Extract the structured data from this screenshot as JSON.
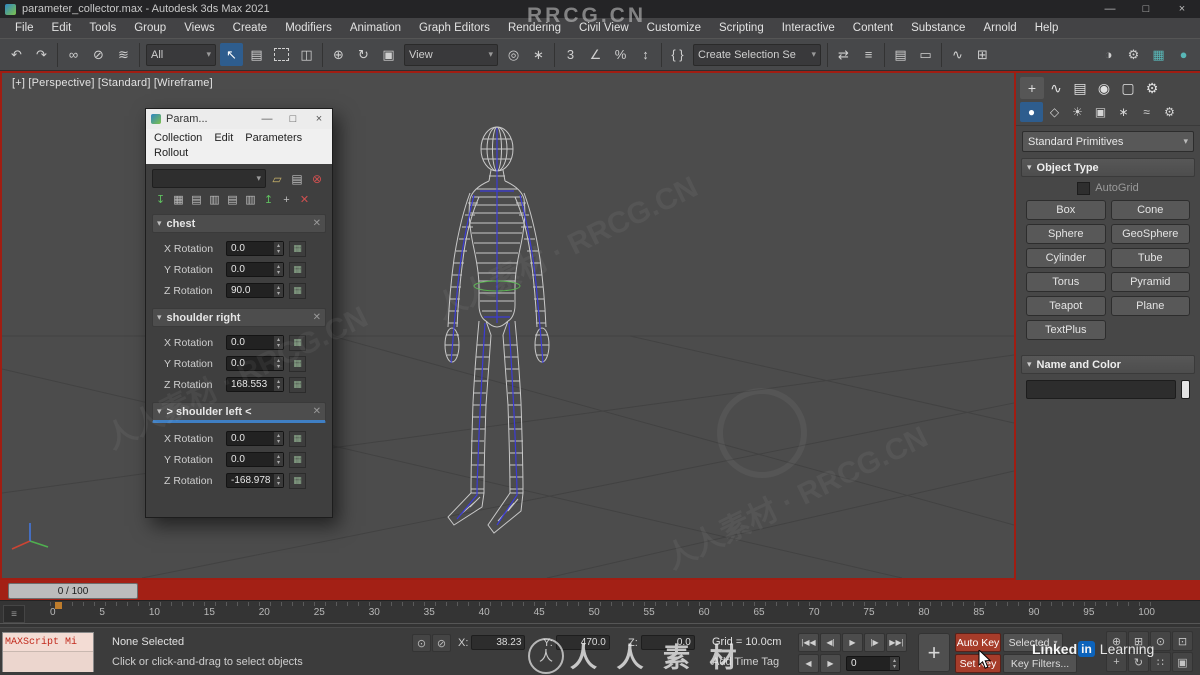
{
  "title_bar": {
    "app_title": "parameter_collector.max - Autodesk 3ds Max 2021",
    "minimize": "—",
    "maximize": "□",
    "close": "×"
  },
  "menu_bar": {
    "items": [
      "File",
      "Edit",
      "Tools",
      "Group",
      "Views",
      "Create",
      "Modifiers",
      "Animation",
      "Graph Editors",
      "Rendering",
      "Civil View",
      "Customize",
      "Scripting",
      "Interactive",
      "Content",
      "Substance",
      "Arnold",
      "Help"
    ]
  },
  "toolbar": {
    "selection_filter_value": "All",
    "view_value": "View",
    "selection_set_value": "Create Selection Se",
    "icons": {
      "undo": "↶",
      "redo": "↷",
      "link": "∞",
      "unlink": "⊘",
      "bind_spacewarp": "≋",
      "select_object": "↖",
      "select_by_name": "▤",
      "window_crossing": "◫",
      "move": "⊕",
      "rotate": "↻",
      "scale": "▣",
      "pivot_center": "◎",
      "manipulate": "∗",
      "snap_3d": "3",
      "snap_angle": "∠",
      "snap_percent": "%",
      "snap_spinner": "↕",
      "named_sets": "{ }",
      "mirror": "⇄",
      "align": "≡",
      "layers": "▤",
      "ribbon": "▭",
      "curve_editor": "∿",
      "schematic": "⊞",
      "material_editor": "◑",
      "render_setup": "⚙",
      "render_frame": "▦",
      "render": "●"
    }
  },
  "viewport": {
    "label": "[+] [Perspective] [Standard] [Wireframe]"
  },
  "param_collector": {
    "title": "Param...",
    "minimize": "—",
    "maximize": "□",
    "close": "×",
    "menu": [
      "Collection",
      "Edit",
      "Parameters",
      "Rollout"
    ],
    "combo_icons": [
      "▱",
      "▤",
      "⊗"
    ],
    "tool_icons": [
      "↧",
      "▦",
      "▤",
      "▥",
      "▤",
      "▥",
      "↥",
      "+",
      "✕"
    ],
    "rollouts": [
      {
        "name": "chest",
        "params": [
          {
            "label": "X Rotation",
            "value": "0.0"
          },
          {
            "label": "Y Rotation",
            "value": "0.0"
          },
          {
            "label": "Z Rotation",
            "value": "90.0"
          }
        ]
      },
      {
        "name": "shoulder right",
        "params": [
          {
            "label": "X Rotation",
            "value": "0.0"
          },
          {
            "label": "Y Rotation",
            "value": "0.0"
          },
          {
            "label": "Z Rotation",
            "value": "168.553"
          }
        ]
      },
      {
        "name": "> shoulder left <",
        "params": [
          {
            "label": "X Rotation",
            "value": "0.0"
          },
          {
            "label": "Y Rotation",
            "value": "0.0"
          },
          {
            "label": "Z Rotation",
            "value": "-168.978"
          }
        ]
      }
    ]
  },
  "command_panel": {
    "tab_glyphs": [
      "+",
      "∿",
      "▤",
      "◉",
      "▢",
      "⚙"
    ],
    "category_glyphs": [
      "●",
      "◇",
      "☀",
      "▣",
      "∗",
      "≈",
      "⚙"
    ],
    "subcategory": "Standard Primitives",
    "object_type_title": "Object Type",
    "autogrid": "AutoGrid",
    "buttons": [
      "Box",
      "Cone",
      "Sphere",
      "GeoSphere",
      "Cylinder",
      "Tube",
      "Torus",
      "Pyramid",
      "Teapot",
      "Plane",
      "TextPlus"
    ],
    "name_color_title": "Name and Color"
  },
  "timeline": {
    "slider_label": "0 / 100",
    "ticks": [
      "0",
      "5",
      "10",
      "15",
      "20",
      "25",
      "30",
      "35",
      "40",
      "45",
      "50",
      "55",
      "60",
      "65",
      "70",
      "75",
      "80",
      "85",
      "90",
      "95",
      "100"
    ]
  },
  "status_bar": {
    "maxscript": "MAXScript Mi",
    "selection_status": "None Selected",
    "prompt": "Click or click-and-drag to select objects",
    "coords": {
      "x_label": "X:",
      "x": "38.23",
      "y_label": "Y:",
      "y": "470.0",
      "z_label": "Z:",
      "z": "0.0"
    },
    "grid_readout": "Grid = 10.0cm",
    "add_time_tag": "Add Time Tag",
    "playback": [
      "|◀◀",
      "◀|",
      "▶",
      "|▶",
      "▶▶|"
    ],
    "frame_step_back": "◀",
    "frame_step_fwd": "▶",
    "frame_value": "0",
    "big_key": "+",
    "auto_key": "Auto Key",
    "set_key": "Set Key",
    "key_mode": "Selected",
    "key_filters": "Key Filters...",
    "nav_glyphs": [
      "⊕",
      "⊞",
      "⊙",
      "⊡",
      "+",
      "↻",
      "∷",
      "▣"
    ]
  },
  "ui_glyphs": {
    "dropdown": "▾",
    "spin_up": "▴",
    "spin_down": "▾",
    "rollout_arrow": "▾",
    "remove": "✕",
    "key": "▦",
    "corner": "≡"
  },
  "watermarks": {
    "top": "RRCG.CN",
    "bottom_cn": "人 人 素 材",
    "circle_char": "人",
    "diagonal": "人人素材 · RRCG.CN",
    "linkedin_pre": "Linked",
    "linkedin_in": "in",
    "linkedin_post": "Learning"
  }
}
